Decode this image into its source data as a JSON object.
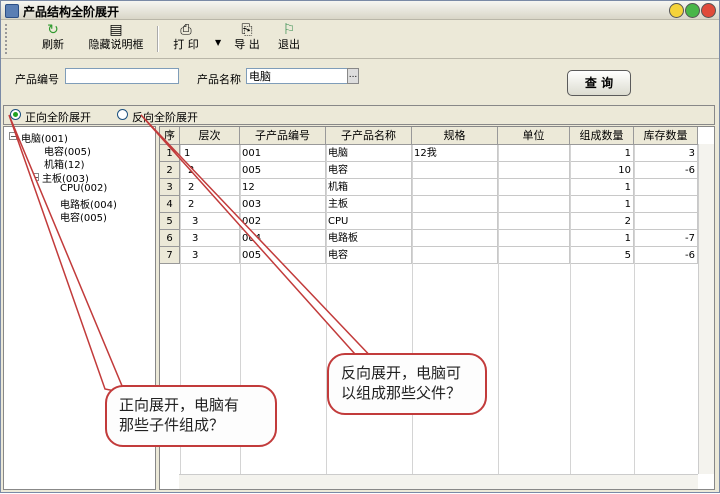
{
  "window": {
    "title": "产品结构全阶展开"
  },
  "toolbar": {
    "refresh": "刷新",
    "hide_desc": "隐藏说明框",
    "print": "打 印",
    "export": "导 出",
    "exit": "退出"
  },
  "form": {
    "code_label": "产品编号",
    "code_value": "",
    "name_label": "产品名称",
    "name_value": "电脑",
    "query": "查 询"
  },
  "radios": {
    "forward": "正向全阶展开",
    "reverse": "反向全阶展开",
    "selected": "forward"
  },
  "tree": [
    "电脑(001)",
    "电容(005)",
    "机箱(12)",
    "主板(003)",
    "CPU(002)",
    "电路板(004)",
    "电容(005)"
  ],
  "grid": {
    "headers": [
      "序号",
      "层次",
      "子产品编号",
      "子产品名称",
      "规格",
      "单位",
      "组成数量",
      "库存数量"
    ],
    "rows": [
      {
        "no": "1",
        "level": "1",
        "code": "001",
        "name": "电脑",
        "spec": "12我",
        "unit": "",
        "qty": "1",
        "stock": "3"
      },
      {
        "no": "2",
        "level": "2",
        "code": "005",
        "name": "电容",
        "spec": "",
        "unit": "",
        "qty": "10",
        "stock": "-6"
      },
      {
        "no": "3",
        "level": "2",
        "code": "12",
        "name": "机箱",
        "spec": "",
        "unit": "",
        "qty": "1",
        "stock": ""
      },
      {
        "no": "4",
        "level": "2",
        "code": "003",
        "name": "主板",
        "spec": "",
        "unit": "",
        "qty": "1",
        "stock": ""
      },
      {
        "no": "5",
        "level": "3",
        "code": "002",
        "name": "CPU",
        "spec": "",
        "unit": "",
        "qty": "2",
        "stock": ""
      },
      {
        "no": "6",
        "level": "3",
        "code": "004",
        "name": "电路板",
        "spec": "",
        "unit": "",
        "qty": "1",
        "stock": "-7"
      },
      {
        "no": "7",
        "level": "3",
        "code": "005",
        "name": "电容",
        "spec": "",
        "unit": "",
        "qty": "5",
        "stock": "-6"
      }
    ]
  },
  "callouts": {
    "reverse_l1": "反向展开，电脑可",
    "reverse_l2": "以组成那些父件？",
    "forward_l1": "正向展开，电脑有",
    "forward_l2": "那些子件组成？"
  },
  "colors": {
    "callout_border": "#c23b3b",
    "window_bg": "#ece9d8"
  }
}
